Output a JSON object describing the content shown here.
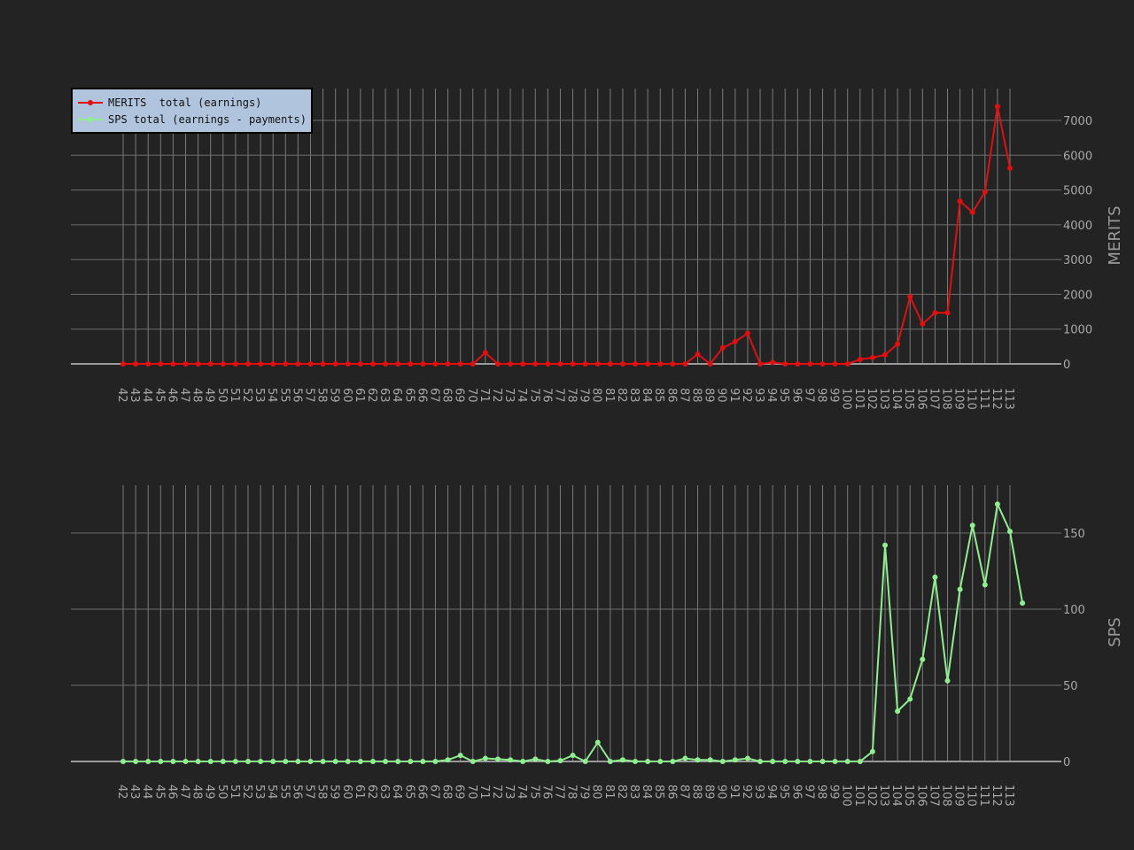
{
  "chart_data": [
    {
      "type": "line",
      "ylabel": "MERITS",
      "ylim": [
        0,
        7800
      ],
      "yticks": [
        0,
        1000,
        2000,
        3000,
        4000,
        5000,
        6000,
        7000
      ],
      "x": [
        42,
        43,
        44,
        45,
        46,
        47,
        48,
        49,
        50,
        51,
        52,
        53,
        54,
        55,
        56,
        57,
        58,
        59,
        60,
        61,
        62,
        63,
        64,
        65,
        66,
        67,
        68,
        69,
        70,
        71,
        72,
        73,
        74,
        75,
        76,
        77,
        78,
        79,
        80,
        81,
        82,
        83,
        84,
        85,
        86,
        87,
        88,
        89,
        90,
        91,
        92,
        93,
        94,
        95,
        96,
        97,
        98,
        99,
        100,
        101,
        102,
        103,
        104,
        105,
        106,
        107,
        108,
        109,
        110,
        111,
        112,
        113
      ],
      "series": [
        {
          "name": "MERITS  total (earnings)",
          "color": "#e01010",
          "values": [
            0,
            0,
            0,
            0,
            0,
            0,
            0,
            0,
            0,
            0,
            0,
            0,
            0,
            0,
            0,
            0,
            0,
            0,
            0,
            0,
            0,
            0,
            0,
            0,
            0,
            0,
            0,
            0,
            0,
            320,
            0,
            0,
            0,
            0,
            0,
            0,
            0,
            0,
            0,
            0,
            0,
            0,
            0,
            0,
            0,
            0,
            280,
            0,
            460,
            640,
            880,
            0,
            40,
            0,
            0,
            0,
            0,
            0,
            0,
            130,
            180,
            260,
            570,
            1930,
            1150,
            1470,
            1470,
            4680,
            4360,
            4940,
            7400,
            5630
          ]
        }
      ],
      "grid": true,
      "legend": "top-left"
    },
    {
      "type": "line",
      "ylabel": "SPS",
      "ylim": [
        0,
        170
      ],
      "yticks": [
        0,
        50,
        100,
        150
      ],
      "x": [
        42,
        43,
        44,
        45,
        46,
        47,
        48,
        49,
        50,
        51,
        52,
        53,
        54,
        55,
        56,
        57,
        58,
        59,
        60,
        61,
        62,
        63,
        64,
        65,
        66,
        67,
        68,
        69,
        70,
        71,
        72,
        73,
        74,
        75,
        76,
        77,
        78,
        79,
        80,
        81,
        82,
        83,
        84,
        85,
        86,
        87,
        88,
        89,
        90,
        91,
        92,
        93,
        94,
        95,
        96,
        97,
        98,
        99,
        100,
        101,
        102,
        103,
        104,
        105,
        106,
        107,
        108,
        109,
        110,
        111,
        112,
        113
      ],
      "series": [
        {
          "name": "SPS total (earnings - payments)",
          "color": "#90ee90",
          "values": [
            0,
            0,
            0,
            0,
            0,
            0,
            0,
            0,
            0,
            0,
            0,
            0,
            0,
            0,
            0,
            0,
            0,
            0,
            0,
            0,
            0,
            0,
            0,
            0,
            0,
            0,
            1,
            4,
            0,
            2,
            1.5,
            1,
            0,
            1.5,
            0,
            0.5,
            4,
            0,
            12.5,
            0,
            1,
            0,
            0,
            0,
            0,
            2,
            1,
            1,
            0,
            1,
            2,
            0,
            0,
            0,
            0,
            0,
            0,
            0,
            0,
            0,
            6.5,
            142,
            33,
            41,
            67,
            121,
            53,
            113,
            155,
            116,
            169,
            151,
            104
          ]
        }
      ],
      "grid": true
    }
  ]
}
